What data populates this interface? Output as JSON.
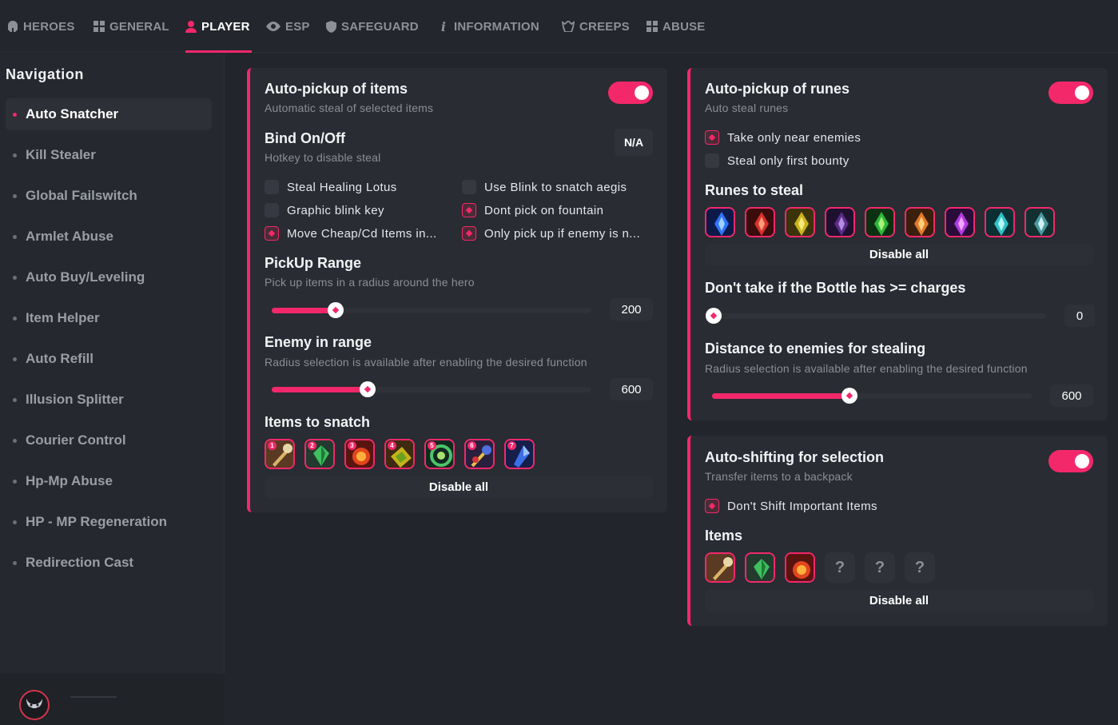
{
  "tabs": [
    {
      "label": "HEROES",
      "icon": "helmet-icon"
    },
    {
      "label": "GENERAL",
      "icon": "grid-icon"
    },
    {
      "label": "PLAYER",
      "icon": "user-icon",
      "active": true
    },
    {
      "label": "ESP",
      "icon": "eye-icon"
    },
    {
      "label": "SAFEGUARD",
      "icon": "shield-icon"
    },
    {
      "label": "INFORMATION",
      "icon": "info-icon"
    },
    {
      "label": "CREEPS",
      "icon": "creep-icon"
    },
    {
      "label": "ABUSE",
      "icon": "grid-icon"
    }
  ],
  "sidebar": {
    "title": "Navigation",
    "items": [
      {
        "label": "Auto Snatcher",
        "active": true
      },
      {
        "label": "Kill Stealer"
      },
      {
        "label": "Global Failswitch"
      },
      {
        "label": "Armlet Abuse"
      },
      {
        "label": "Auto Buy/Leveling"
      },
      {
        "label": "Item Helper"
      },
      {
        "label": "Auto Refill"
      },
      {
        "label": "Illusion Splitter"
      },
      {
        "label": "Courier Control"
      },
      {
        "label": "Hp-Mp Abuse"
      },
      {
        "label": "HP - MP Regeneration"
      },
      {
        "label": "Redirection Cast"
      }
    ]
  },
  "items_panel": {
    "title": "Auto-pickup of items",
    "subtitle": "Automatic steal of selected items",
    "enabled": true,
    "bind_title": "Bind On/Off",
    "bind_subtitle": "Hotkey to disable steal",
    "bind_value": "N/A",
    "checks": [
      {
        "label": "Steal Healing Lotus",
        "checked": false
      },
      {
        "label": "Use Blink to snatch aegis",
        "checked": false
      },
      {
        "label": "Graphic blink key",
        "checked": false
      },
      {
        "label": "Dont pick on fountain",
        "checked": true
      },
      {
        "label": "Move Cheap/Cd Items in...",
        "checked": true
      },
      {
        "label": "Only pick up if enemy is n...",
        "checked": true
      }
    ],
    "pickup_title": "PickUp Range",
    "pickup_subtitle": "Pick up items in a radius around the hero",
    "pickup_value": "200",
    "pickup_level": 0.2,
    "enemy_title": "Enemy in range",
    "enemy_subtitle": "Radius selection is available after enabling the desired function",
    "enemy_value": "600",
    "enemy_level": 0.3,
    "snatch_title": "Items to snatch",
    "snatch_numbers": [
      "1",
      "2",
      "3",
      "4",
      "5",
      "6",
      "7"
    ],
    "disable_label": "Disable all"
  },
  "runes_panel": {
    "title": "Auto-pickup of runes",
    "subtitle": "Auto steal runes",
    "enabled": true,
    "checks": [
      {
        "label": "Take only near enemies",
        "checked": true
      },
      {
        "label": "Steal only first bounty",
        "checked": false
      }
    ],
    "runes_title": "Runes to steal",
    "disable_label": "Disable all",
    "bottle_title": "Don't take if the Bottle has >= charges",
    "bottle_value": "0",
    "bottle_level": 0,
    "distance_title": "Distance to enemies for stealing",
    "distance_subtitle": "Radius selection is available after enabling the desired function",
    "distance_value": "600",
    "distance_level": 0.43
  },
  "shift_panel": {
    "title": "Auto-shifting for selection",
    "subtitle": "Transfer items to a backpack",
    "enabled": true,
    "check_label": "Don't Shift Important Items",
    "items_title": "Items",
    "empty_slot": "?",
    "disable_label": "Disable all"
  },
  "colors": {
    "accent": "#f3286b",
    "background": "#22252b",
    "panel": "#292c33"
  }
}
